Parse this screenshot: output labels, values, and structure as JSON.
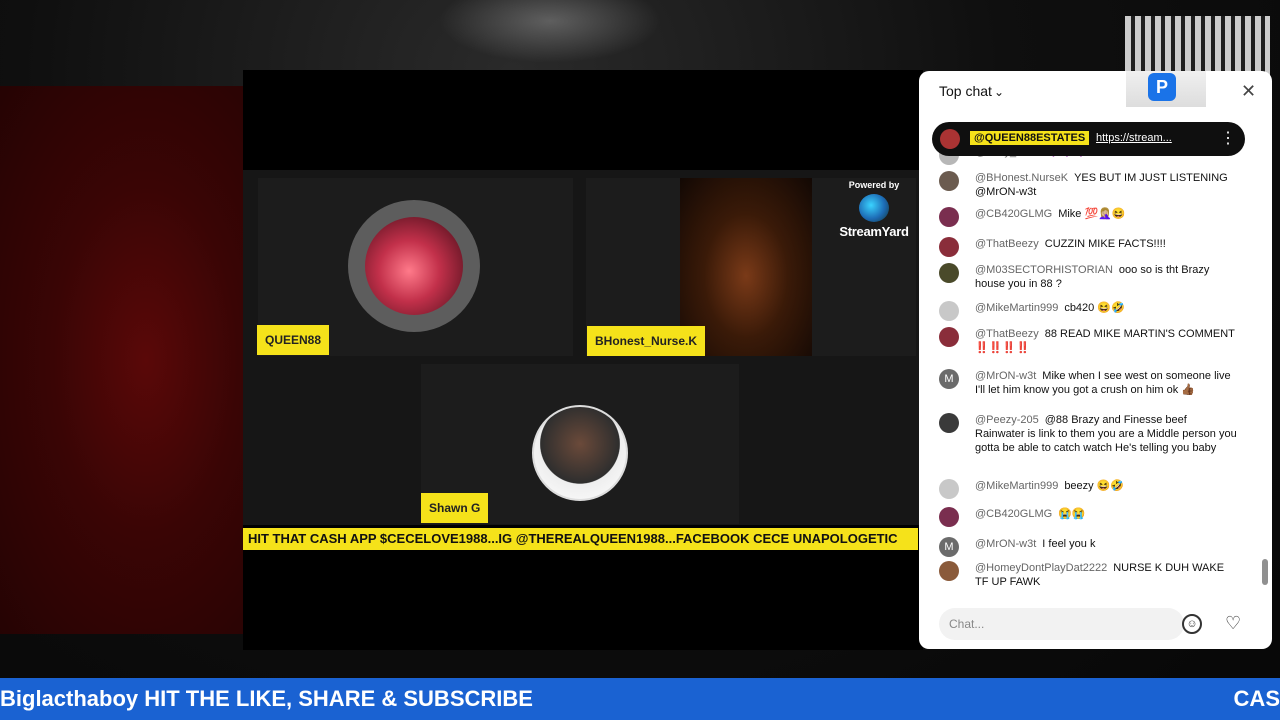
{
  "stream": {
    "participants": [
      {
        "name": "QUEEN88"
      },
      {
        "name": "BHonest_Nurse.K"
      },
      {
        "name": "Shawn G"
      }
    ],
    "powered_by": "Powered by",
    "brand": "StreamYard",
    "ticker": "HIT THAT CASH APP $CECELOVE1988...IG @THEREALQUEEN1988...FACEBOOK CECE UNAPOLOGETIC"
  },
  "banner": {
    "left_text": "Biglacthaboy HIT THE LIKE, SHARE & SUBSCRIBE",
    "right_text": "CAS"
  },
  "chat": {
    "title": "Top chat",
    "pinned": {
      "user": "@QUEEN88ESTATES",
      "link": "https://stream..."
    },
    "messages": [
      {
        "user": "@Gray_1961",
        "text": "💜💜💜",
        "avatar_color": "#b7b7b7"
      },
      {
        "user": "@BHonest.NurseK",
        "text": "YES BUT IM JUST LISTENING @MrON-w3t",
        "avatar_color": "#6b5b4f"
      },
      {
        "user": "@CB420GLMG",
        "text": "Mike 💯🤦🏼‍♀️😆",
        "avatar_color": "#7a2e4f"
      },
      {
        "user": "@ThatBeezy",
        "text": "CUZZIN MIKE FACTS!!!!",
        "avatar_color": "#8a2d3a"
      },
      {
        "user": "@M03SECTORHISTORIAN",
        "text": "ooo so is tht Brazy house you in 88 ?",
        "avatar_color": "#4a4a2a"
      },
      {
        "user": "@MikeMartin999",
        "text": "cb420 😆🤣",
        "avatar_color": "#c8c8c8"
      },
      {
        "user": "@ThatBeezy",
        "text": "88 READ MIKE MARTIN'S COMMENT ‼️‼️‼️‼️",
        "avatar_color": "#8a2d3a"
      },
      {
        "user": "@MrON-w3t",
        "text": "Mike when I see west on someone live I'll let him know you got a crush on him ok 👍🏾",
        "avatar_color": "#6b6b6b",
        "avatar_letter": "M"
      },
      {
        "user": "@Peezy-205",
        "text": "@88 Brazy and Finesse beef Rainwater is link to them you are a Middle person you gotta be able to catch watch He's telling you baby",
        "avatar_color": "#3a3a3a"
      },
      {
        "user": "@MikeMartin999",
        "text": "beezy 😆🤣",
        "avatar_color": "#c8c8c8"
      },
      {
        "user": "@CB420GLMG",
        "text": "😭😭",
        "avatar_color": "#7a2e4f"
      },
      {
        "user": "@MrON-w3t",
        "text": "I feel you k",
        "avatar_color": "#6b6b6b",
        "avatar_letter": "M"
      },
      {
        "user": "@HomeyDontPlayDat2222",
        "text": "NURSE K DUH WAKE TF UP FAWK",
        "avatar_color": "#8a5a3a"
      }
    ],
    "input_placeholder": "Chat...",
    "icons": {
      "emoji": "smile-icon",
      "heart": "heart-icon",
      "close": "close-icon",
      "menu": "more-vert-icon"
    }
  },
  "colors": {
    "accent_yellow": "#f5e21a",
    "banner_blue": "#1a62d2"
  }
}
